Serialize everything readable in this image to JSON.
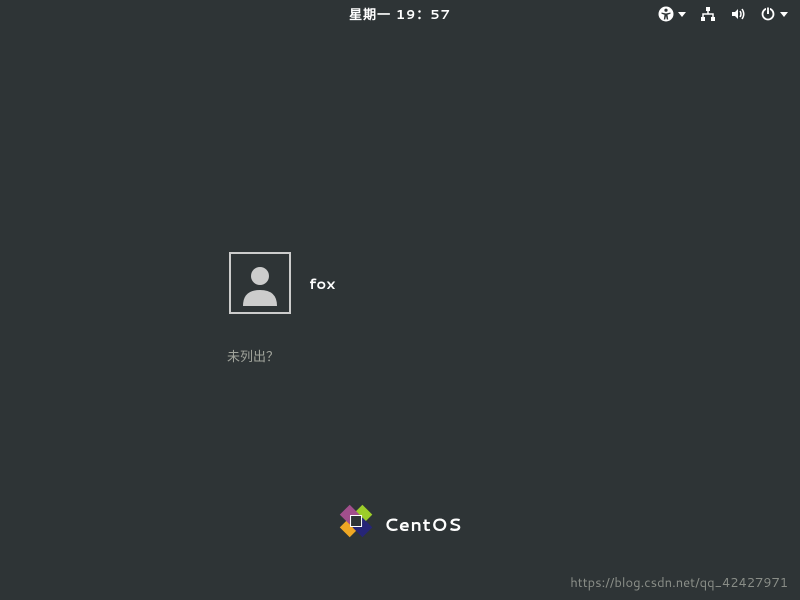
{
  "topbar": {
    "datetime": "星期一 19：57"
  },
  "login": {
    "users": [
      {
        "name": "fox"
      }
    ],
    "not_listed_label": "未列出？"
  },
  "branding": {
    "os_name": "CentOS"
  },
  "watermark": {
    "text": "https://blog.csdn.net/qq_42427971"
  }
}
